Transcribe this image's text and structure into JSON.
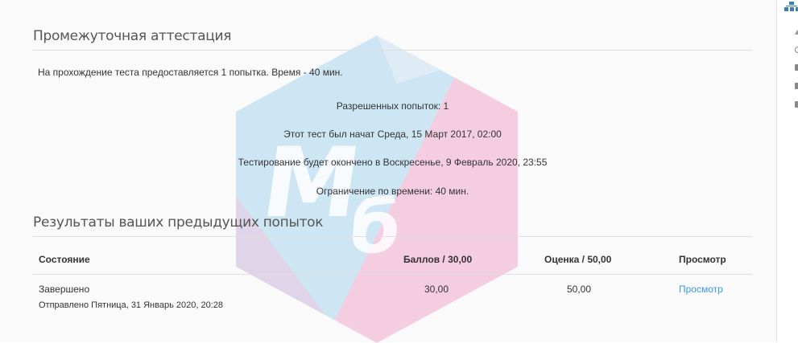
{
  "quiz": {
    "title": "Промежуточная аттестация",
    "intro": "На прохождение теста предоставляется 1 попытка. Время - 40 мин.",
    "attempts_allowed": "Разрешенных попыток: 1",
    "opened": "Этот тест был начат Среда, 15 Март 2017, 02:00",
    "closes": "Тестирование будет окончено в Воскресенье, 9 Февраль 2020, 23:55",
    "time_limit": "Ограничение по времени: 40 мин."
  },
  "results": {
    "title": "Результаты ваших предыдущих попыток",
    "headers": {
      "state": "Состояние",
      "marks": "Баллов / 30,00",
      "grade": "Оценка / 50,00",
      "review": "Просмотр"
    },
    "rows": [
      {
        "state": "Завершено",
        "submitted": "Отправлено Пятница, 31 Январь 2020, 20:28",
        "marks": "30,00",
        "grade": "50,00",
        "review": "Просмотр"
      }
    ]
  },
  "colors": {
    "link": "#3a9ad9",
    "watermark_blue": "#a9d6ee",
    "watermark_pink": "#f0a8cc"
  },
  "watermark": {
    "letters": "МБ"
  },
  "icons": {
    "sidebar_top": "blocks-icon"
  }
}
